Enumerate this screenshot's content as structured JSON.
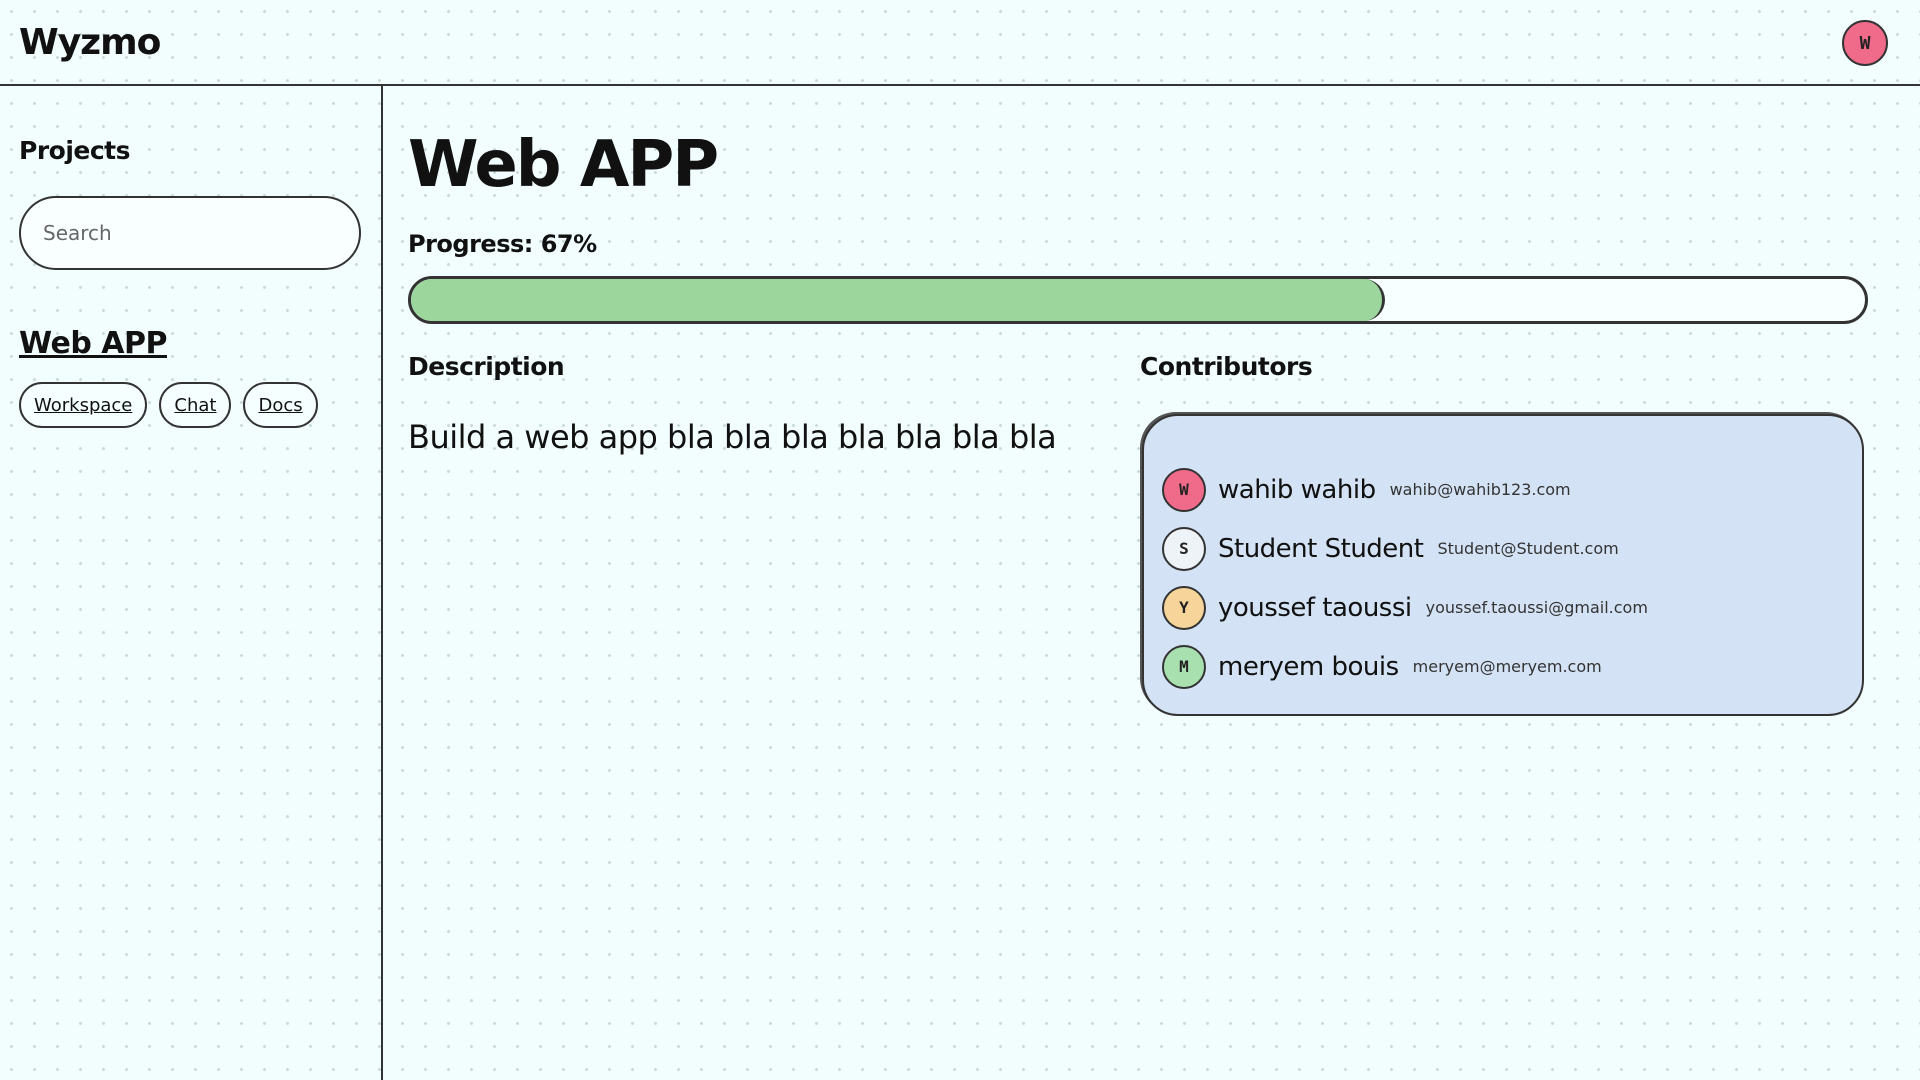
{
  "header": {
    "app_title": "Wyzmo",
    "user_avatar": {
      "initial": "W",
      "color": "#f06b8a"
    }
  },
  "sidebar": {
    "heading": "Projects",
    "search_placeholder": "Search",
    "project": {
      "name": "Web APP",
      "links": [
        "Workspace",
        "Chat",
        "Docs"
      ]
    }
  },
  "main": {
    "title": "Web APP",
    "progress_label": "Progress: 67%",
    "progress_value": 0.67,
    "progress_color": "#9cd69c",
    "description_heading": "Description",
    "description_text": "Build a web app bla bla bla bla bla bla bla",
    "contributors_heading": "Contributors",
    "contributors": [
      {
        "initial": "W",
        "name": "wahib wahib",
        "email": "wahib@wahib123.com",
        "color": "#f06b8a"
      },
      {
        "initial": "S",
        "name": "Student Student",
        "email": "Student@Student.com",
        "color": "#eef3f8"
      },
      {
        "initial": "Y",
        "name": "youssef taoussi",
        "email": "youssef.taoussi@gmail.com",
        "color": "#f6d49a"
      },
      {
        "initial": "M",
        "name": "meryem bouis",
        "email": "meryem@meryem.com",
        "color": "#a8e0b0"
      }
    ]
  }
}
